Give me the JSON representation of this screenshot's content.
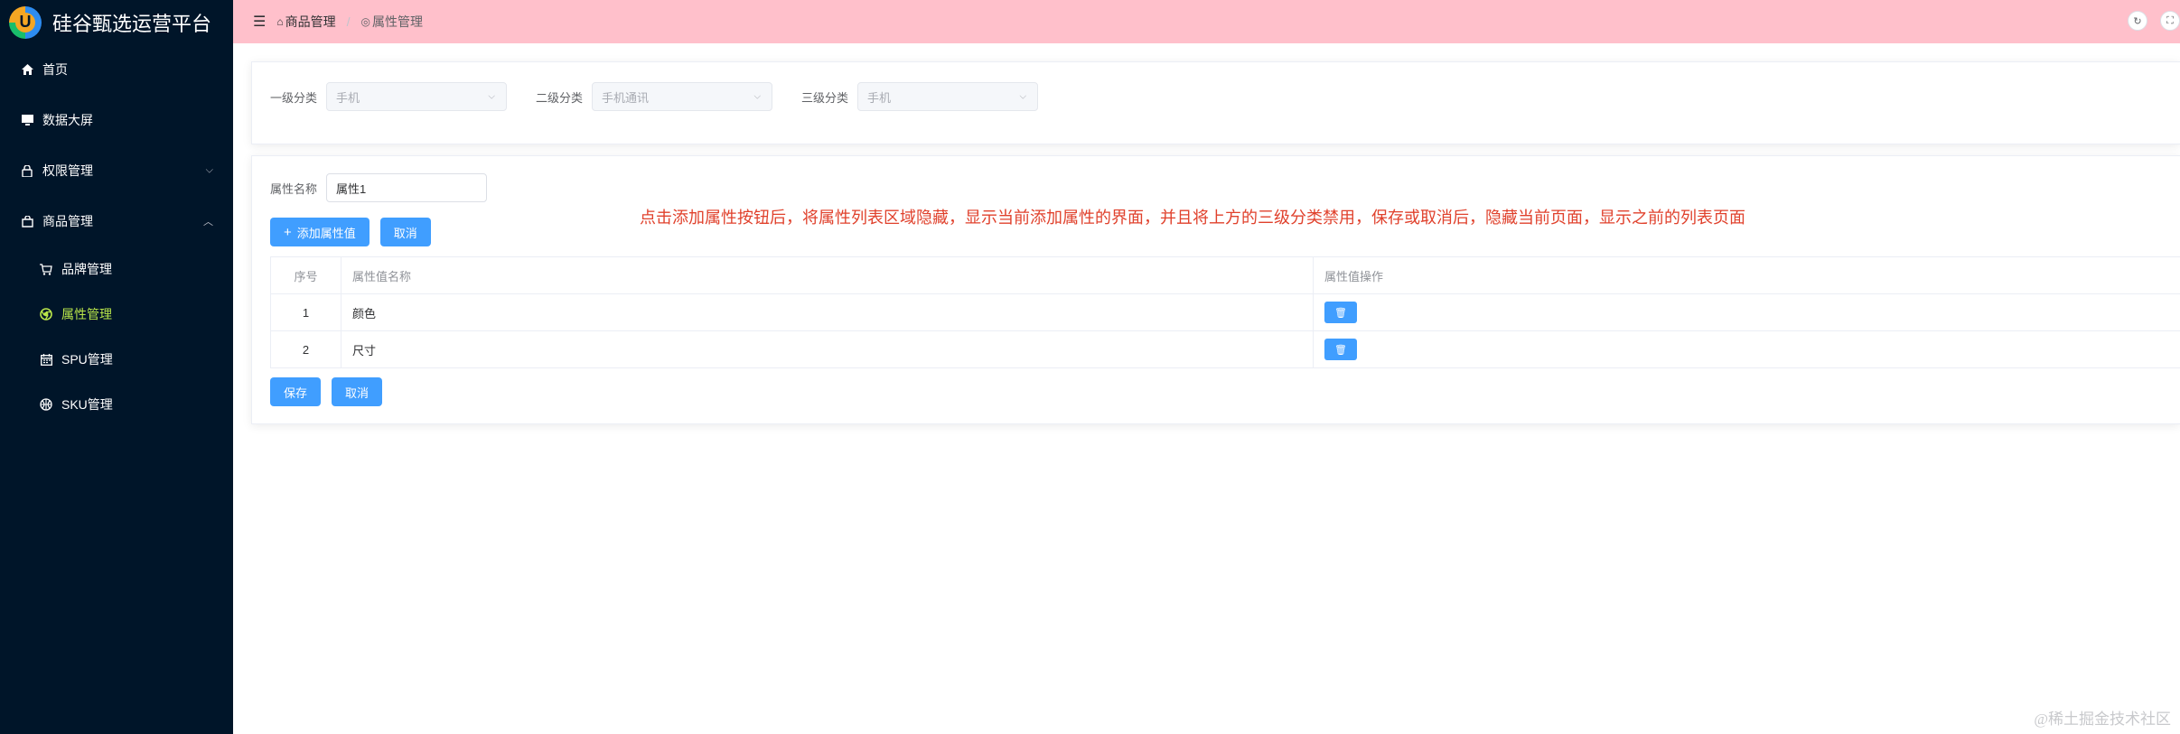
{
  "app": {
    "title": "硅谷甄选运营平台",
    "logo_letter": "U"
  },
  "sidebar": {
    "items": [
      {
        "label": "首页",
        "icon": "home-icon"
      },
      {
        "label": "数据大屏",
        "icon": "monitor-icon"
      },
      {
        "label": "权限管理",
        "icon": "lock-icon",
        "expanded": false
      },
      {
        "label": "商品管理",
        "icon": "bag-icon",
        "expanded": true
      }
    ],
    "sub_items": [
      {
        "label": "品牌管理",
        "icon": "cart-icon",
        "active": false
      },
      {
        "label": "属性管理",
        "icon": "chrome-icon",
        "active": true
      },
      {
        "label": "SPU管理",
        "icon": "calendar-icon",
        "active": false
      },
      {
        "label": "SKU管理",
        "icon": "basketball-icon",
        "active": false
      }
    ],
    "active_color": "#b9e54a"
  },
  "header": {
    "breadcrumb": [
      {
        "label": "商品管理",
        "icon": "bag-icon"
      },
      {
        "label": "属性管理",
        "icon": "chrome-icon"
      }
    ],
    "background": "#ffc0cb"
  },
  "filters": [
    {
      "label": "一级分类",
      "value": "手机"
    },
    {
      "label": "二级分类",
      "value": "手机通讯"
    },
    {
      "label": "三级分类",
      "value": "手机"
    }
  ],
  "form": {
    "attr_label": "属性名称",
    "attr_value": "属性1",
    "add_value_label": "添加属性值",
    "cancel_label": "取消"
  },
  "notice": "点击添加属性按钮后，将属性列表区域隐藏，显示当前添加属性的界面，并且将上方的三级分类禁用，保存或取消后，隐藏当前页面，显示之前的列表页面",
  "table": {
    "headers": [
      "序号",
      "属性值名称",
      "属性值操作"
    ],
    "rows": [
      {
        "index": "1",
        "name": "颜色"
      },
      {
        "index": "2",
        "name": "尺寸"
      }
    ]
  },
  "actions": {
    "save_label": "保存",
    "cancel_label": "取消"
  },
  "watermark": "@稀土掘金技术社区",
  "colors": {
    "primary": "#409eff",
    "sidebar_bg": "#001529",
    "notice": "#e0412c"
  }
}
